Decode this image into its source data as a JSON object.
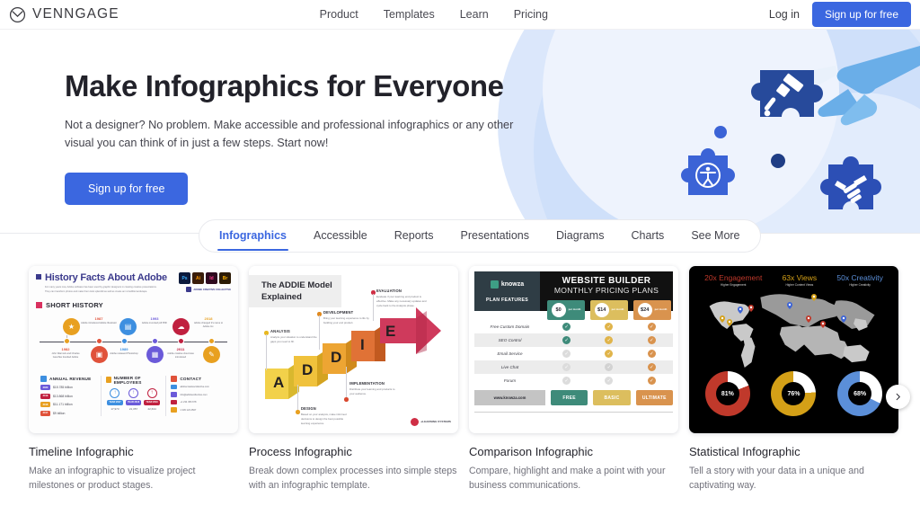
{
  "brand": {
    "name": "VENNGAGE",
    "logo_icon": "venn-circle-logo",
    "accent": "#3b67e0"
  },
  "header": {
    "nav": [
      {
        "label": "Product"
      },
      {
        "label": "Templates"
      },
      {
        "label": "Learn"
      },
      {
        "label": "Pricing"
      }
    ],
    "login_label": "Log in",
    "signup_label": "Sign up for free"
  },
  "hero": {
    "title": "Make Infographics for Everyone",
    "subtitle": "Not a designer? No problem. Make accessible and professional infographics or any other visual you can think of in just a few steps. Start now!",
    "cta_label": "Sign up for free",
    "illustration_icons": [
      "paintbrush-puzzle-piece",
      "accessibility-puzzle-piece",
      "handshake-puzzle-piece",
      "pointing-hand"
    ]
  },
  "tabs": {
    "active": "Infographics",
    "items": [
      {
        "label": "Infographics"
      },
      {
        "label": "Accessible"
      },
      {
        "label": "Reports"
      },
      {
        "label": "Presentations"
      },
      {
        "label": "Diagrams"
      },
      {
        "label": "Charts"
      },
      {
        "label": "See More"
      }
    ]
  },
  "carousel": {
    "next_icon": "chevron-right-icon"
  },
  "cards": [
    {
      "title": "Timeline Infographic",
      "desc": "Make an infographic to visualize project milestones or product stages.",
      "thumb": {
        "kind": "adobe-timeline",
        "title": "History Facts About Adobe",
        "paragraph": "For many years now, Adobe software has been used by graphic designers in creating creative presentations. They can transform photos and make them look splendid as well as create an incredible landscape.",
        "badges": [
          {
            "label": "Ps",
            "bg": "#0c1a3c",
            "fg": "#3ab0ff"
          },
          {
            "label": "Ai",
            "bg": "#3a1d0a",
            "fg": "#ff9a00"
          },
          {
            "label": "Id",
            "bg": "#2e0a1f",
            "fg": "#ff3a8c"
          },
          {
            "label": "Br",
            "bg": "#2b1a05",
            "fg": "#ffb200"
          }
        ],
        "brandline": "ADOBE CREATIVE COLLECTIVE",
        "section": "SHORT HISTORY",
        "events": [
          {
            "year": "1982",
            "caption": "John Warnock and Charles Geschke founded Adobe",
            "color": "#e8a020",
            "side": "bottom",
            "icon": "lightbulb-icon"
          },
          {
            "year": "1987",
            "caption": "Adobe introduced Adobe Illustrator",
            "color": "#e0523a",
            "side": "top",
            "icon": "layers-icon"
          },
          {
            "year": "1989",
            "caption": "Adobe released Photoshop",
            "color": "#3d8fe0",
            "side": "bottom",
            "icon": "window-icon"
          },
          {
            "year": "1993",
            "caption": "Adobe invented pdf PDF",
            "color": "#6b5ad9",
            "side": "top",
            "icon": "document-icon"
          },
          {
            "year": "2011",
            "caption": "Adobe creative cloud was introduced",
            "color": "#c0203f",
            "side": "bottom",
            "icon": "cloud-icon"
          },
          {
            "year": "2018",
            "caption": "Adobe changed it's name to Adobe Inc.",
            "color": "#e8a020",
            "side": "top",
            "icon": "pen-icon"
          }
        ],
        "panels": [
          {
            "title": "ANNUAL REVENUE",
            "color": "#3d8fe0",
            "rows": [
              {
                "tag": "2020",
                "tag_color": "#6b5ad9",
                "text": "$15.785 billion"
              },
              {
                "tag": "2019",
                "tag_color": "#c0203f",
                "text": "$13.868 billion"
              },
              {
                "tag": "2018",
                "tag_color": "#e8a020",
                "text": "$11.171 billion"
              },
              {
                "tag": "2017",
                "tag_color": "#e0523a",
                "text": "$9 billion"
              }
            ]
          },
          {
            "title": "NUMBER OF EMPLOYEES",
            "color": "#e8a020",
            "employees": [
              {
                "pill": "YEAR 2017",
                "pill_color": "#3d8fe0",
                "count": "17,973",
                "ring": "#3d8fe0"
              },
              {
                "pill": "YEAR 2018",
                "pill_color": "#6b5ad9",
                "count": "21,357",
                "ring": "#6b5ad9"
              },
              {
                "pill": "YEAR 2019",
                "pill_color": "#c0203f",
                "count": "22,634",
                "ring": "#c0203f"
              }
            ]
          },
          {
            "title": "CONTACT",
            "color": "#e0523a",
            "contacts": [
              {
                "icon": "mail-icon",
                "color": "#3d8fe0",
                "text": "adobecreativecollective.com"
              },
              {
                "icon": "globe-icon",
                "color": "#6b5ad9",
                "text": "info@adobecollective.com"
              },
              {
                "icon": "phone-icon",
                "color": "#c0203f",
                "text": "+1 234 456 678"
              },
              {
                "icon": "location-icon",
                "color": "#e8a020",
                "text": "1 345 123 4567"
              }
            ]
          }
        ]
      }
    },
    {
      "title": "Process Infographic",
      "desc": "Break down complex processes into simple steps with an infographic template.",
      "thumb": {
        "kind": "addie-model",
        "title": "The ADDIE Model Explained",
        "steps": [
          {
            "letter": "A",
            "label": "ANALYSIS",
            "desc": "Analyze your situation to understand the gaps you need to fill.",
            "color": "#f2d14a",
            "dark": "#d9b82e",
            "dot": "#e8b820"
          },
          {
            "letter": "D",
            "label": "DESIGN",
            "desc": "Based on your analysis, make informed decisions to design the best possible learning experience.",
            "color": "#f0c23c",
            "dark": "#d4a320",
            "dot": "#e8a020"
          },
          {
            "letter": "D",
            "label": "DEVELOPMENT",
            "desc": "Bring your learning experience to life by building your end product.",
            "color": "#eda533",
            "dark": "#d08a1c",
            "dot": "#e08a20"
          },
          {
            "letter": "I",
            "label": "IMPLEMENTATION",
            "desc": "Distribute your learning and products to your audience.",
            "color": "#e07236",
            "dark": "#c25a20",
            "dot": "#d9482e"
          },
          {
            "letter": "E",
            "label": "EVALUATION",
            "desc": "Evaluate if your learning end product is effective. Make any necessary updates and cycle back to the Analysis phase.",
            "color": "#cf3a5c",
            "dark": "#b02848",
            "dot": "#cf2e45"
          }
        ],
        "logo_text": "eLEARNING SYSTEMS"
      }
    },
    {
      "title": "Comparison Infographic",
      "desc": "Compare, highlight and make a point with your business communications.",
      "thumb": {
        "kind": "pricing-table",
        "brand": "knowza",
        "heading_1": "WEBSITE BUILDER",
        "heading_2": "MONTHLY PRICING PLANS",
        "features_header": "PLAN FEATURES",
        "plans": [
          {
            "price": "$0",
            "per": "per month",
            "color": "#3e8b7a",
            "tag": "FREE",
            "tag_color": "#3e8b7a"
          },
          {
            "price": "$14",
            "per": "per month",
            "color": "#dcbe5e",
            "tag": "BASIC",
            "tag_color": "#dcbe5e"
          },
          {
            "price": "$24",
            "per": "per month",
            "color": "#d9934e",
            "tag": "ULTIMATE",
            "tag_color": "#d9934e"
          }
        ],
        "features": [
          {
            "name": "Free Custom Domain",
            "marks": [
              "check-on",
              "check-mid",
              "check-mid"
            ]
          },
          {
            "name": "SEO Control",
            "marks": [
              "check-on",
              "check-mid",
              "check-mid"
            ]
          },
          {
            "name": "Email Service",
            "marks": [
              "check-off",
              "check-mid",
              "check-mid"
            ]
          },
          {
            "name": "Live Chat",
            "marks": [
              "check-off",
              "check-off",
              "check-mid"
            ]
          },
          {
            "name": "Forum",
            "marks": [
              "check-off",
              "check-off",
              "check-mid"
            ]
          }
        ],
        "url": "www.knowza.com"
      }
    },
    {
      "title": "Statistical Infographic",
      "desc": "Tell a story with your data in a unique and captivating way.",
      "thumb": {
        "kind": "statistical-dark",
        "stats": [
          {
            "value": "20x Engagement",
            "label": "Higher Engagement",
            "color": "#c0392b"
          },
          {
            "value": "63x Views",
            "label": "Higher Content Views",
            "color": "#d4a017"
          },
          {
            "value": "50x Creativity",
            "label": "Higher Creativity",
            "color": "#5b8fd9"
          }
        ],
        "donuts": [
          {
            "value": "81%",
            "pct": 81,
            "color": "#c0392b"
          },
          {
            "value": "76%",
            "pct": 76,
            "color": "#d4a017"
          },
          {
            "value": "68%",
            "pct": 68,
            "color": "#5b8fd9"
          }
        ]
      }
    }
  ]
}
